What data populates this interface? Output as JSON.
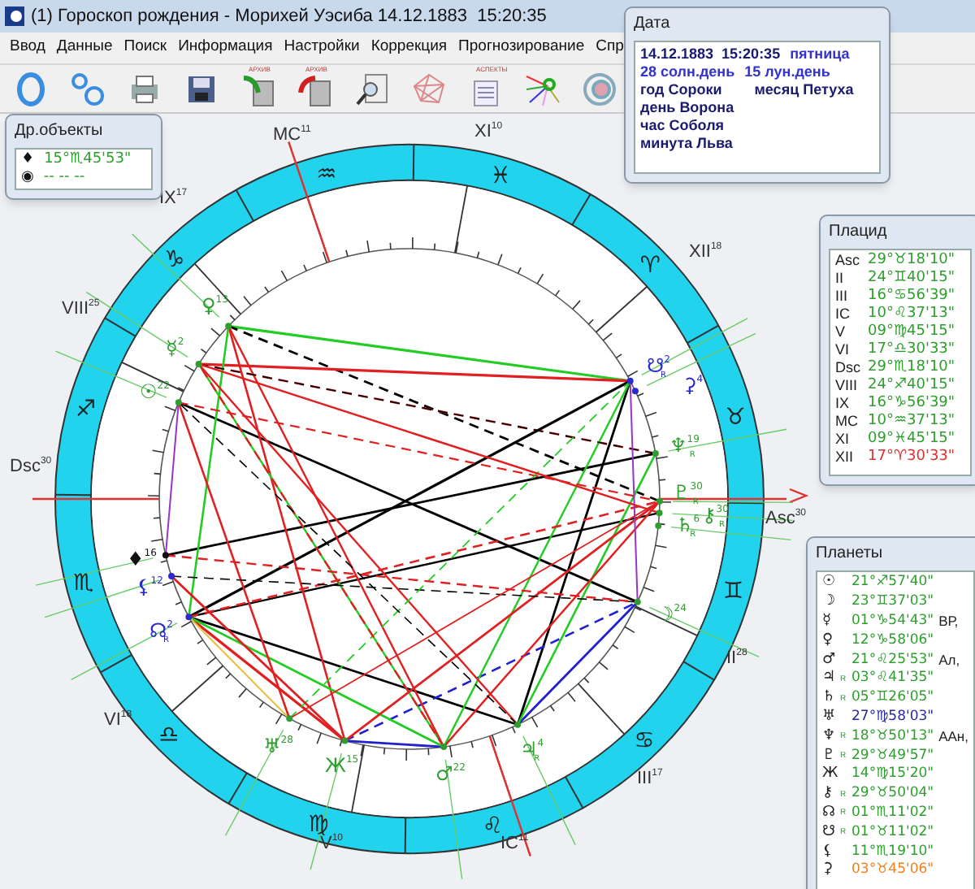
{
  "window": {
    "title": "(1) Гороскоп рождения - Морихей Уэсиба 14.12.1883  15:20:35"
  },
  "menu": [
    "Ввод",
    "Данные",
    "Поиск",
    "Информация",
    "Настройки",
    "Коррекция",
    "Прогнозирование",
    "Спр"
  ],
  "toolbar": [
    {
      "kind": "circle"
    },
    {
      "kind": "circles"
    },
    {
      "kind": "printer"
    },
    {
      "kind": "save"
    },
    {
      "kind": "archive-in",
      "label": "АРХИВ"
    },
    {
      "kind": "archive-out",
      "label": "АРХИВ"
    },
    {
      "kind": "search"
    },
    {
      "kind": "web"
    },
    {
      "kind": "aspects",
      "label": "АСПЕКТЫ"
    },
    {
      "kind": "rays"
    },
    {
      "kind": "disc"
    }
  ],
  "date_panel": {
    "title": "Дата",
    "lines": [
      {
        "parts": [
          {
            "text": "14.12.1883  15:20:35",
            "color": "#1a1a6e"
          },
          {
            "text": "пятница",
            "color": "#3333cc"
          }
        ]
      },
      {
        "parts": [
          {
            "text": "28 солн.день",
            "color": "#3333cc"
          },
          {
            "text": "15 лун.день",
            "color": "#3333cc"
          }
        ]
      },
      {
        "parts": [
          {
            "text": "год Сороки",
            "color": "#1a1a6e"
          },
          {
            "text": "месяц Петуха",
            "color": "#1a1a6e"
          }
        ]
      },
      {
        "parts": [
          {
            "text": "день Ворона",
            "color": "#1a1a6e"
          }
        ]
      },
      {
        "parts": [
          {
            "text": "час Соболя",
            "color": "#1a1a6e"
          }
        ]
      },
      {
        "parts": [
          {
            "text": "минута Льва",
            "color": "#1a1a6e"
          }
        ]
      }
    ]
  },
  "other_objects": {
    "title": "Др.объекты",
    "rows": [
      {
        "glyph": "♦",
        "value": "15°♏45'53\""
      },
      {
        "glyph": "◉",
        "value": "-- -- --"
      }
    ]
  },
  "houses": {
    "title": "Плацид",
    "rows": [
      {
        "name": "Asc",
        "value": "29°♉18'10\"",
        "color": "#2e9e2e"
      },
      {
        "name": "II",
        "value": "24°♊40'15\"",
        "color": "#2e9e2e"
      },
      {
        "name": "III",
        "value": "16°♋56'39\"",
        "color": "#2e9e2e"
      },
      {
        "name": "IC",
        "value": "10°♌37'13\"",
        "color": "#2e9e2e"
      },
      {
        "name": "V",
        "value": "09°♍45'15\"",
        "color": "#2e9e2e"
      },
      {
        "name": "VI",
        "value": "17°♎30'33\"",
        "color": "#2e9e2e"
      },
      {
        "name": "Dsc",
        "value": "29°♏18'10\"",
        "color": "#2e9e2e"
      },
      {
        "name": "VIII",
        "value": "24°♐40'15\"",
        "color": "#2e9e2e"
      },
      {
        "name": "IX",
        "value": "16°♑56'39\"",
        "color": "#2e9e2e"
      },
      {
        "name": "MC",
        "value": "10°♒37'13\"",
        "color": "#2e9e2e"
      },
      {
        "name": "XI",
        "value": "09°♓45'15\"",
        "color": "#2e9e2e"
      },
      {
        "name": "XII",
        "value": "17°♈30'33\"",
        "color": "#e03030"
      }
    ]
  },
  "planets": {
    "title": "Планеты",
    "rows": [
      {
        "glyph": "☉",
        "value": "21°♐57'40\"",
        "color": "#2e9e2e"
      },
      {
        "glyph": "☽",
        "value": "23°♊37'03\"",
        "color": "#2e9e2e"
      },
      {
        "glyph": "☿",
        "value": "01°♑54'43\"",
        "color": "#2e9e2e",
        "note": "ВР,"
      },
      {
        "glyph": "♀",
        "value": "12°♑58'06\"",
        "color": "#2e9e2e"
      },
      {
        "glyph": "♂",
        "value": "21°♌25'53\"",
        "color": "#2e9e2e",
        "note": "Ал,"
      },
      {
        "glyph": "♃",
        "retro": "R",
        "value": "03°♌41'35\"",
        "color": "#2e9e2e"
      },
      {
        "glyph": "♄",
        "retro": "R",
        "value": "05°♊26'05\"",
        "color": "#2e9e2e"
      },
      {
        "glyph": "♅",
        "value": "27°♍58'03\"",
        "color": "#2a2a9e"
      },
      {
        "glyph": "♆",
        "retro": "R",
        "value": "18°♉50'13\"",
        "color": "#2e9e2e",
        "note": "ААн,"
      },
      {
        "glyph": "♇",
        "retro": "R",
        "value": "29°♉49'57\"",
        "color": "#2e9e2e"
      },
      {
        "glyph": "Ж",
        "value": "14°♍15'20\"",
        "color": "#2e9e2e"
      },
      {
        "glyph": "⚷",
        "retro": "R",
        "value": "29°♉50'04\"",
        "color": "#2e9e2e"
      },
      {
        "glyph": "☊",
        "retro": "R",
        "value": "01°♏11'02\"",
        "color": "#2e9e2e"
      },
      {
        "glyph": "☋",
        "retro": "R",
        "value": "01°♉11'02\"",
        "color": "#2e9e2e"
      },
      {
        "glyph": "⚸",
        "value": "11°♏19'10\"",
        "color": "#2e9e2e"
      },
      {
        "glyph": "⚳",
        "value": "03°♉45'06\"",
        "color": "#f08020"
      }
    ]
  },
  "chart": {
    "signs": [
      "♈",
      "♉",
      "♊",
      "♋",
      "♌",
      "♍",
      "♎",
      "♏",
      "♐",
      "♑",
      "♒",
      "♓"
    ],
    "house_labels": [
      {
        "name": "Asc",
        "degree": "30"
      },
      {
        "name": "II",
        "degree": "28"
      },
      {
        "name": "III",
        "degree": "17"
      },
      {
        "name": "IC",
        "degree": "11"
      },
      {
        "name": "V",
        "degree": "10"
      },
      {
        "name": "VI",
        "degree": "18"
      },
      {
        "name": "Dsc",
        "degree": "30"
      },
      {
        "name": "VIII",
        "degree": "25"
      },
      {
        "name": "IX",
        "degree": "17"
      },
      {
        "name": "MC",
        "degree": "11"
      },
      {
        "name": "XI",
        "degree": "10"
      },
      {
        "name": "XII",
        "degree": "18"
      }
    ],
    "planet_marks": [
      {
        "glyph": "♀",
        "degree": "13",
        "color": "#2e9e2e"
      },
      {
        "glyph": "☿",
        "degree": "2",
        "color": "#2e9e2e"
      },
      {
        "glyph": "☋",
        "degree": "2",
        "retro": "R",
        "color": "#2a2ad0"
      },
      {
        "glyph": "⚳",
        "degree": "4",
        "color": "#2a2ad0"
      },
      {
        "glyph": "☉",
        "degree": "22",
        "color": "#2e9e2e"
      },
      {
        "glyph": "♆",
        "degree": "19",
        "retro": "R",
        "color": "#2e9e2e"
      },
      {
        "glyph": "♇",
        "degree": "30",
        "retro": "R",
        "color": "#2e9e2e"
      },
      {
        "glyph": "⚷",
        "degree": "30",
        "retro": "R",
        "color": "#2e9e2e"
      },
      {
        "glyph": "♄",
        "degree": "6",
        "retro": "R",
        "color": "#2e9e2e"
      },
      {
        "glyph": "♦",
        "degree": "16",
        "color": "#111111"
      },
      {
        "glyph": "⚸",
        "degree": "12",
        "color": "#2a2ad0"
      },
      {
        "glyph": "☽",
        "degree": "24",
        "color": "#2e9e2e"
      },
      {
        "glyph": "☊",
        "degree": "2",
        "retro": "R",
        "color": "#2a2ad0"
      },
      {
        "glyph": "♅",
        "degree": "28",
        "color": "#2e9e2e"
      },
      {
        "glyph": "♃",
        "degree": "4",
        "retro": "R",
        "color": "#2e9e2e"
      },
      {
        "glyph": "Ж",
        "degree": "15",
        "color": "#2e9e2e"
      },
      {
        "glyph": "♂",
        "degree": "22",
        "color": "#2e9e2e"
      }
    ]
  }
}
